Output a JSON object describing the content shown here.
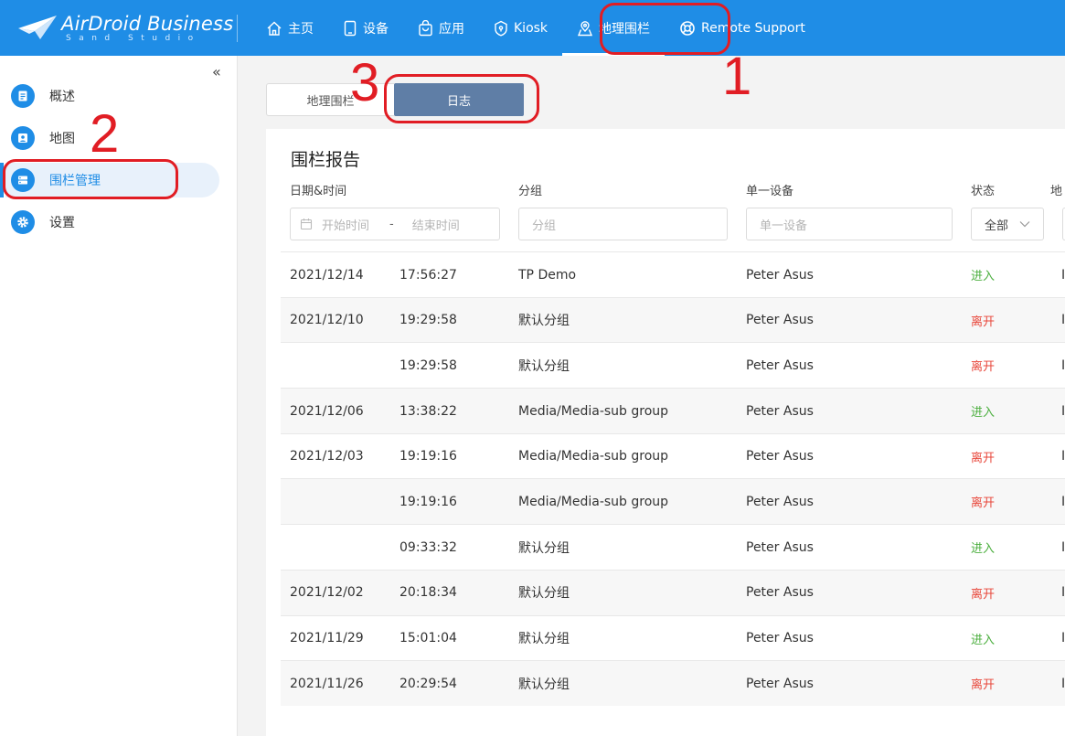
{
  "brand": {
    "title": "AirDroid Business",
    "subtitle": "Sand Studio"
  },
  "nav": [
    {
      "label": "主页",
      "icon": "home-icon"
    },
    {
      "label": "设备",
      "icon": "tablet-icon"
    },
    {
      "label": "应用",
      "icon": "bag-icon"
    },
    {
      "label": "Kiosk",
      "icon": "kiosk-icon"
    },
    {
      "label": "地理围栏",
      "icon": "map-pin-icon",
      "active": true
    },
    {
      "label": "Remote Support",
      "icon": "lifebuoy-icon"
    }
  ],
  "sidebar": {
    "collapse_glyph": "«",
    "items": [
      {
        "label": "概述",
        "icon": "document-icon"
      },
      {
        "label": "地图",
        "icon": "map-pin-icon"
      },
      {
        "label": "围栏管理",
        "icon": "list-icon",
        "active": true
      },
      {
        "label": "设置",
        "icon": "gear-icon"
      }
    ]
  },
  "tabs": {
    "geofence": "地理围栏",
    "log": "日志"
  },
  "report": {
    "title": "围栏报告",
    "filters": {
      "datetime_label": "日期&时间",
      "start_placeholder": "开始时间",
      "range_sep": "-",
      "end_placeholder": "结束时间",
      "group_label": "分组",
      "group_placeholder": "分组",
      "device_label": "单一设备",
      "device_placeholder": "单一设备",
      "status_label": "状态",
      "status_value": "全部",
      "extra_label": "地"
    },
    "rows": [
      {
        "date": "2021/12/14",
        "time": "17:56:27",
        "group": "TP Demo",
        "device": "Peter Asus",
        "status": "进入",
        "type": "enter",
        "extra": "I"
      },
      {
        "date": "2021/12/10",
        "time": "19:29:58",
        "group": "默认分组",
        "device": "Peter Asus",
        "status": "离开",
        "type": "leave",
        "extra": "I"
      },
      {
        "date": "",
        "time": "19:29:58",
        "group": "默认分组",
        "device": "Peter Asus",
        "status": "离开",
        "type": "leave",
        "extra": "I"
      },
      {
        "date": "2021/12/06",
        "time": "13:38:22",
        "group": "Media/Media-sub group",
        "device": "Peter Asus",
        "status": "进入",
        "type": "enter",
        "extra": "I"
      },
      {
        "date": "2021/12/03",
        "time": "19:19:16",
        "group": "Media/Media-sub group",
        "device": "Peter Asus",
        "status": "离开",
        "type": "leave",
        "extra": "I"
      },
      {
        "date": "",
        "time": "19:19:16",
        "group": "Media/Media-sub group",
        "device": "Peter Asus",
        "status": "离开",
        "type": "leave",
        "extra": "I"
      },
      {
        "date": "",
        "time": "09:33:32",
        "group": "默认分组",
        "device": "Peter Asus",
        "status": "进入",
        "type": "enter",
        "extra": "I"
      },
      {
        "date": "2021/12/02",
        "time": "20:18:34",
        "group": "默认分组",
        "device": "Peter Asus",
        "status": "离开",
        "type": "leave",
        "extra": "I"
      },
      {
        "date": "2021/11/29",
        "time": "15:01:04",
        "group": "默认分组",
        "device": "Peter Asus",
        "status": "进入",
        "type": "enter",
        "extra": "I"
      },
      {
        "date": "2021/11/26",
        "time": "20:29:54",
        "group": "默认分组",
        "device": "Peter Asus",
        "status": "离开",
        "type": "leave",
        "extra": "I"
      }
    ]
  },
  "annotations": [
    "1",
    "2",
    "3"
  ],
  "colors": {
    "primary": "#1f8de6",
    "tab_active": "#5f7ea6",
    "enter": "#4caf3f",
    "leave": "#e8473b",
    "annotation": "#e11d24"
  }
}
